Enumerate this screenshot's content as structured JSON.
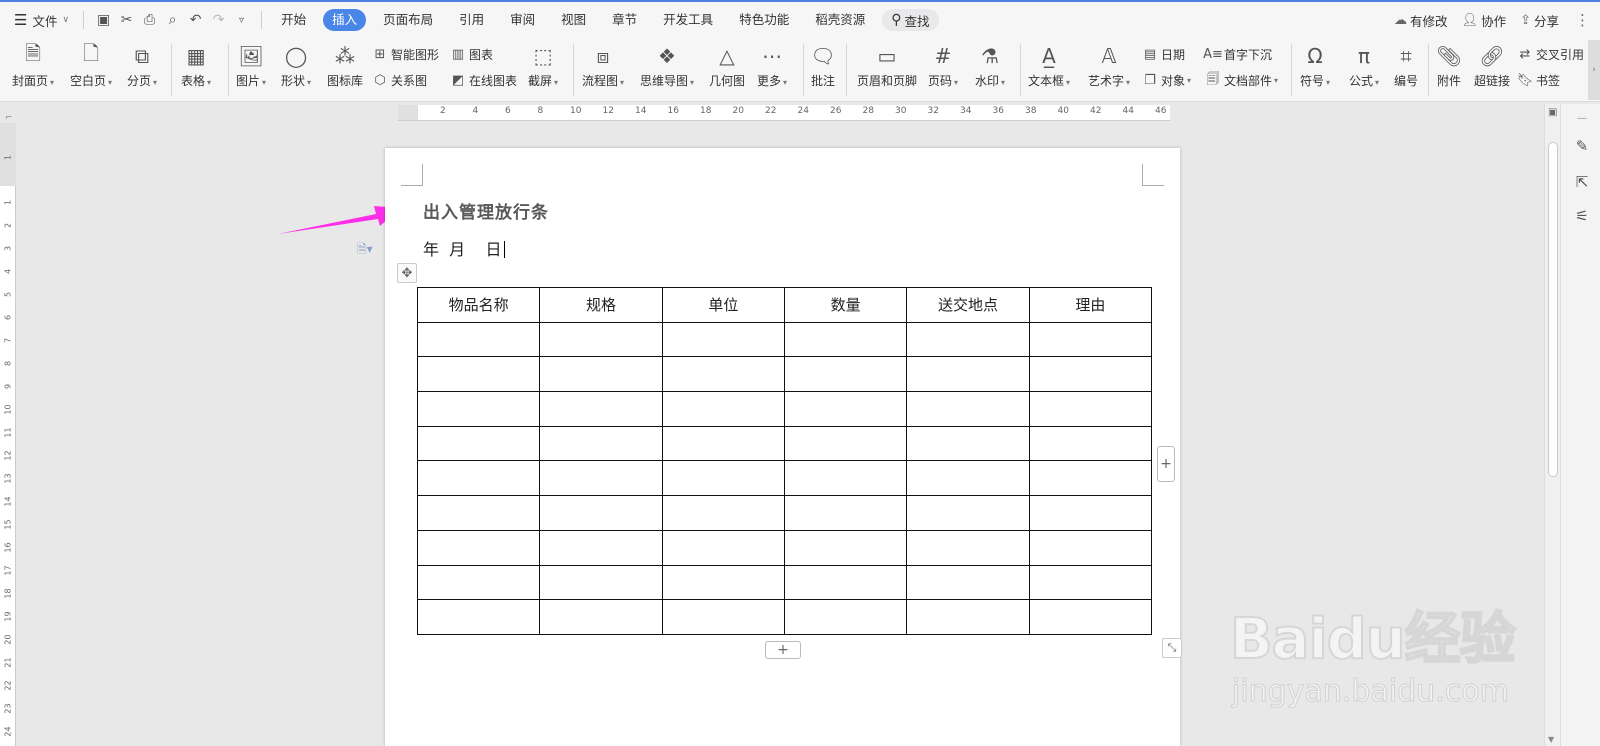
{
  "topbar": {
    "file_label": "文件",
    "tabs": [
      {
        "label": "开始",
        "active": false
      },
      {
        "label": "插入",
        "active": true
      },
      {
        "label": "页面布局",
        "active": false
      },
      {
        "label": "引用",
        "active": false
      },
      {
        "label": "审阅",
        "active": false
      },
      {
        "label": "视图",
        "active": false
      },
      {
        "label": "章节",
        "active": false
      },
      {
        "label": "开发工具",
        "active": false
      },
      {
        "label": "特色功能",
        "active": false
      },
      {
        "label": "稻壳资源",
        "active": false
      }
    ],
    "search_label": "查找",
    "right": {
      "modified": "有修改",
      "collab": "协作",
      "share": "分享"
    }
  },
  "ribbon": {
    "cover": "封面页",
    "blank": "空白页",
    "page_break": "分页",
    "table": "表格",
    "picture": "图片",
    "shape": "形状",
    "icon_lib": "图标库",
    "smart_art": "智能图形",
    "relation": "关系图",
    "chart": "图表",
    "online_chart": "在线图表",
    "screenshot": "截屏",
    "flowchart": "流程图",
    "mindmap": "思维导图",
    "geometry": "几何图",
    "more": "更多",
    "comment": "批注",
    "header_footer": "页眉和页脚",
    "page_number": "页码",
    "watermark": "水印",
    "textbox": "文本框",
    "wordart": "艺术字",
    "date": "日期",
    "object": "对象",
    "dropcap": "首字下沉",
    "doc_parts": "文档部件",
    "symbol": "符号",
    "formula": "公式",
    "numbering": "编号",
    "attachment": "附件",
    "hyperlink": "超链接",
    "cross_ref": "交叉引用",
    "bookmark": "书签"
  },
  "ruler": {
    "h_ticks": [
      "2",
      "4",
      "6",
      "8",
      "10",
      "12",
      "14",
      "16",
      "18",
      "20",
      "22",
      "24",
      "26",
      "28",
      "30",
      "32",
      "34",
      "36",
      "38",
      "40",
      "42",
      "44",
      "46"
    ],
    "v_ticks": [
      "1",
      "1",
      "2",
      "3",
      "4",
      "5",
      "6",
      "7",
      "8",
      "9",
      "10",
      "11",
      "12",
      "13",
      "14",
      "15",
      "16",
      "17",
      "18",
      "19",
      "20",
      "21",
      "22",
      "23",
      "24"
    ]
  },
  "document": {
    "title": "出入管理放行条",
    "date_line": "年  月    日",
    "table_headers": [
      "物品名称",
      "规格",
      "单位",
      "数量",
      "送交地点",
      "理由"
    ],
    "empty_rows": 9
  },
  "watermark": {
    "brand": "Baidu经验",
    "url": "jingyan.baidu.com"
  },
  "colors": {
    "accent": "#4a86e8",
    "arrow": "#ff2ee8"
  }
}
